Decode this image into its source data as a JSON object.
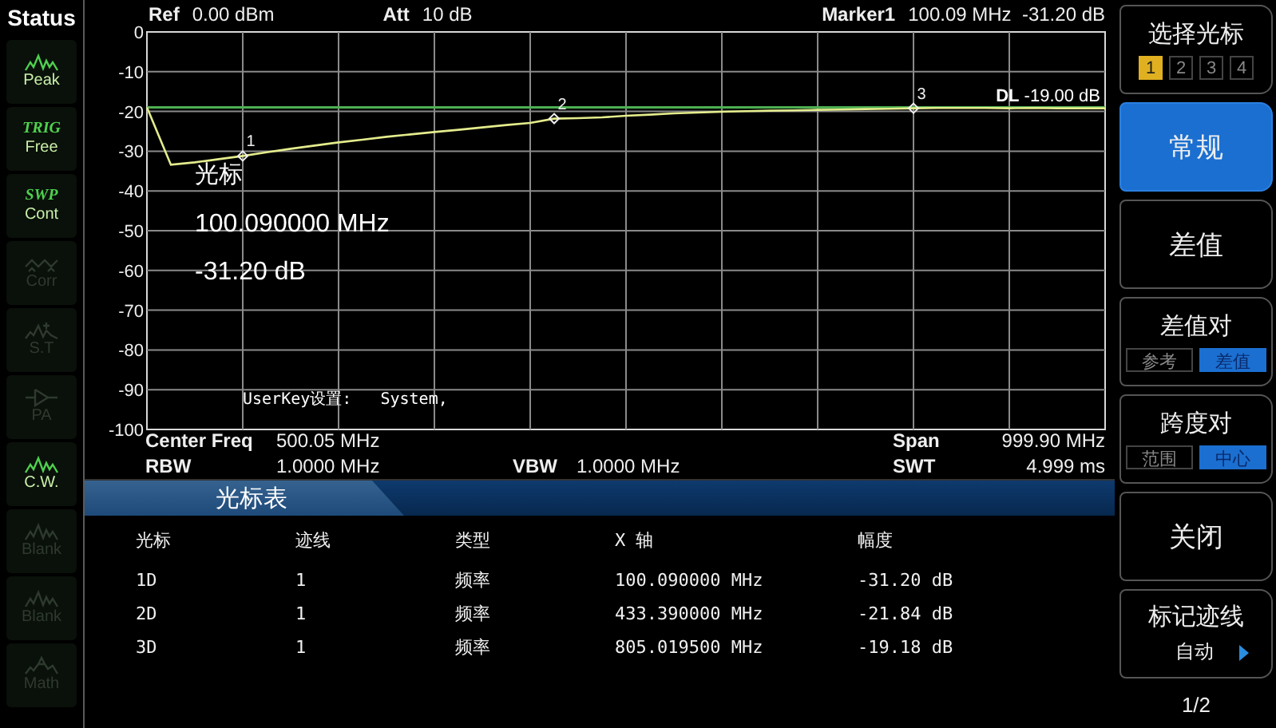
{
  "status_panel": {
    "title": "Status",
    "items": [
      {
        "kind": "wave",
        "label": "Peak",
        "active": true
      },
      {
        "kind": "text",
        "tag": "TRIG",
        "label": "Free",
        "active": true
      },
      {
        "kind": "text",
        "tag": "SWP",
        "label": "Cont",
        "active": true
      },
      {
        "kind": "corr",
        "label": "Corr",
        "active": false
      },
      {
        "kind": "star",
        "label": "S.T",
        "active": false
      },
      {
        "kind": "amp",
        "label": "PA",
        "active": false
      },
      {
        "kind": "wave",
        "label": "C.W.",
        "active": true
      },
      {
        "kind": "wave",
        "label": "Blank",
        "active": false
      },
      {
        "kind": "wave",
        "label": "Blank",
        "active": false
      },
      {
        "kind": "math",
        "label": "Math",
        "active": false
      }
    ]
  },
  "header": [
    {
      "label": "Ref",
      "value": "0.00 dBm"
    },
    {
      "label": "Att",
      "value": "10 dB"
    },
    {
      "label": "Marker1",
      "value": "100.09 MHz  -31.20 dB"
    }
  ],
  "plot": {
    "chart_data": {
      "type": "line",
      "ylim": [
        -100,
        0
      ],
      "grid": true,
      "ref_lines": [
        {
          "axis": "y",
          "value": -19,
          "color": "#4caf50"
        }
      ],
      "yticks": [
        0,
        -10,
        -20,
        -30,
        -40,
        -50,
        -60,
        -70,
        -80,
        -90,
        -100
      ],
      "categories": [
        null,
        null,
        null,
        null,
        null,
        null,
        null,
        null,
        null,
        null,
        null,
        null,
        null,
        null,
        null,
        null,
        null,
        null,
        null,
        null,
        null,
        null,
        null,
        null,
        null,
        null,
        null,
        null,
        null,
        null,
        null,
        null,
        null,
        null,
        null,
        null,
        null,
        null,
        null,
        null,
        null
      ],
      "series": [
        {
          "color": "#e4ec8c",
          "values": [
            -19,
            -33.4,
            -32.8,
            -32,
            -31.2,
            -30.3,
            -29.4,
            -28.6,
            -27.8,
            -27.1,
            -26.4,
            -25.8,
            -25.2,
            -24.6,
            -24,
            -23.4,
            -22.9,
            -21.8,
            -21.7,
            -21.5,
            -21.1,
            -20.8,
            -20.5,
            -20.3,
            -20.1,
            -19.9,
            -19.8,
            -19.7,
            -19.6,
            -19.5,
            -19.4,
            -19.3,
            -19.2,
            -19.1,
            -19.1,
            -19.1,
            -19.2,
            -19.1,
            -19.2,
            -19.2,
            -19.2
          ]
        }
      ]
    },
    "marker_labels": [
      "1",
      "2",
      "3"
    ],
    "display_line": {
      "label": "DL",
      "value": "-19.00 dB"
    },
    "marker_readout": {
      "title": "光标",
      "frequency": "100.090000 MHz",
      "amplitude": "-31.20 dB"
    },
    "note": "UserKey设置:   System,"
  },
  "settings": [
    {
      "left": {
        "label": "Center Freq",
        "value": "500.05 MHz"
      },
      "right": {
        "label": "Span",
        "value": "999.90 MHz"
      }
    },
    {
      "left": {
        "label": "RBW",
        "value": "1.0000 MHz"
      },
      "middle": {
        "label": "VBW",
        "value": "1.0000 MHz"
      },
      "right": {
        "label": "SWT",
        "value": "4.999 ms"
      }
    }
  ],
  "marker_table": {
    "title": "光标表",
    "columns": [
      "光标",
      "迹线",
      "类型",
      "X 轴",
      "幅度"
    ],
    "rows": [
      [
        "1D",
        "1",
        "频率",
        "100.090000 MHz",
        "-31.20 dB"
      ],
      [
        "2D",
        "1",
        "频率",
        "433.390000 MHz",
        "-21.84 dB"
      ],
      [
        "3D",
        "1",
        "频率",
        "805.019500 MHz",
        "-19.18 dB"
      ]
    ]
  },
  "softkeys": [
    {
      "kind": "selector",
      "label": "选择光标",
      "options": [
        {
          "label": "1",
          "selected": true
        },
        {
          "label": "2",
          "selected": false
        },
        {
          "label": "3",
          "selected": false
        },
        {
          "label": "4",
          "selected": false
        }
      ]
    },
    {
      "kind": "plain",
      "label": "常规",
      "selected": true
    },
    {
      "kind": "plain",
      "label": "差值",
      "selected": false
    },
    {
      "kind": "toggle",
      "label": "差值对",
      "options": [
        {
          "label": "参考",
          "selected": false
        },
        {
          "label": "差值",
          "selected": true
        }
      ]
    },
    {
      "kind": "toggle",
      "label": "跨度对",
      "options": [
        {
          "label": "范围",
          "selected": false
        },
        {
          "label": "中心",
          "selected": true
        }
      ]
    },
    {
      "kind": "plain",
      "label": "关闭",
      "selected": false
    },
    {
      "kind": "submenu",
      "label": "标记迹线",
      "value": "自动"
    }
  ],
  "page": "1/2"
}
